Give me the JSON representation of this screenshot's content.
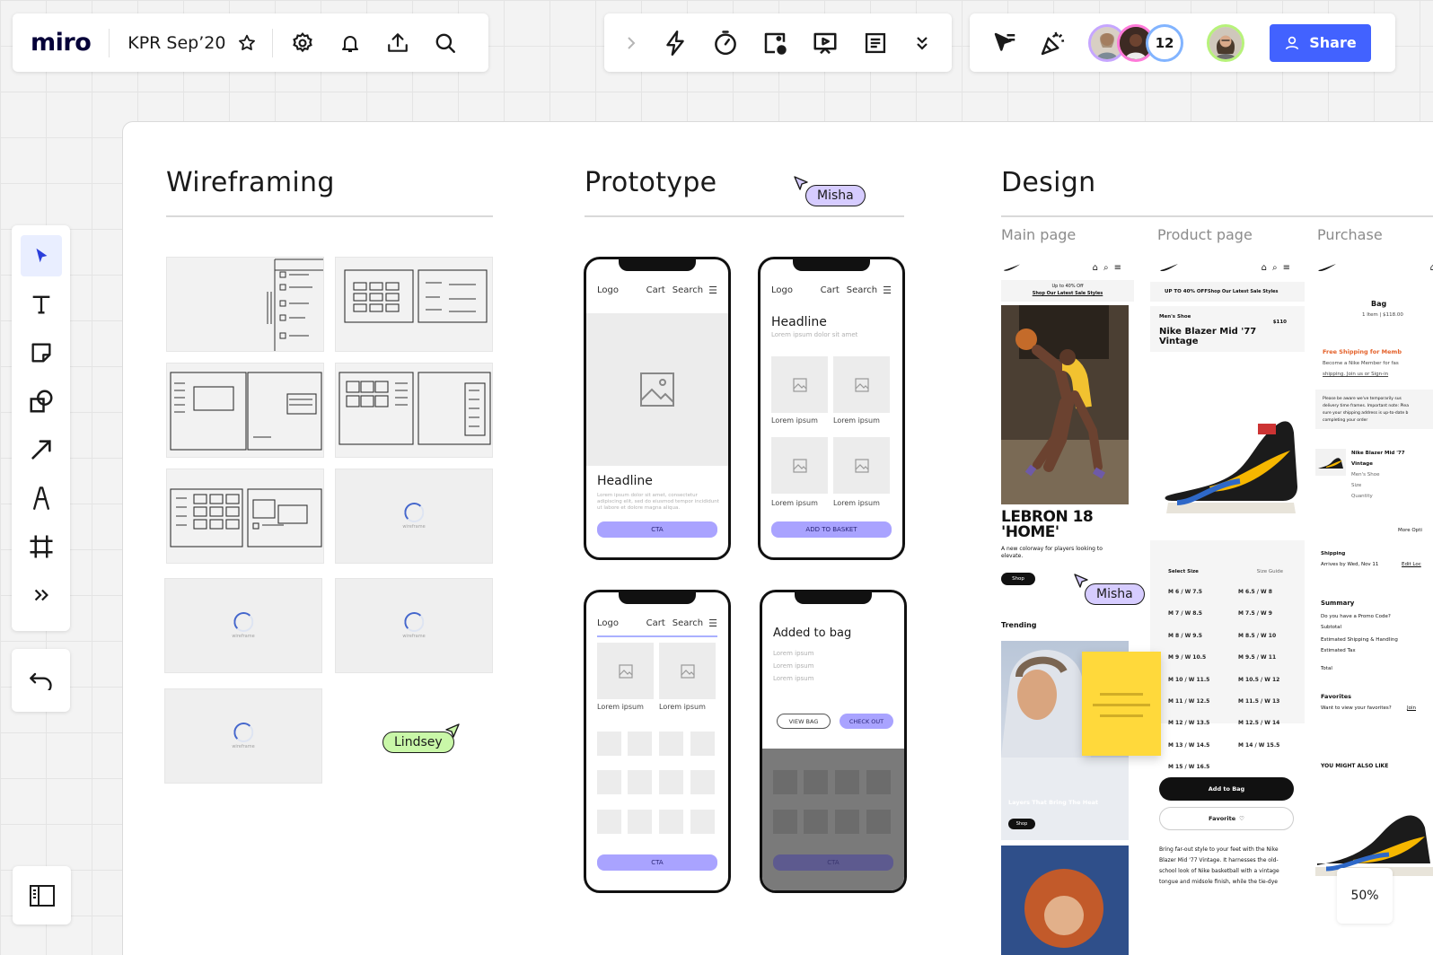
{
  "app": {
    "logo": "miro",
    "board_title": "KPR Sep’20",
    "collaborators_count": "12",
    "share_label": "Share",
    "zoom": "50%"
  },
  "icons": {
    "top_left": [
      "star-icon",
      "gear-icon",
      "bell-icon",
      "upload-icon",
      "search-icon"
    ],
    "top_middle": [
      "chevron-right-icon",
      "lightning-icon",
      "timer-icon",
      "image-plus-icon",
      "present-icon",
      "notes-icon",
      "double-chevron-down-icon"
    ],
    "top_right": [
      "cursor-list-icon",
      "celebrate-icon"
    ],
    "toolbar": [
      "select-icon",
      "text-icon",
      "sticky-note-icon",
      "shapes-icon",
      "arrow-icon",
      "pen-icon",
      "frame-icon",
      "more-icon"
    ]
  },
  "colors": {
    "brand": "#4262ff",
    "cta_purple": "#a9a3ff",
    "misha_tag": "#d6ccff",
    "lindsey_tag": "#c9f7a8",
    "sticky": "#ffd93b"
  },
  "sections": {
    "wireframing": {
      "title": "Wireframing",
      "loader_label": "wireframe"
    },
    "prototype": {
      "title": "Prototype"
    },
    "design": {
      "title": "Design",
      "columns": [
        "Main page",
        "Product page",
        "Purchase"
      ]
    }
  },
  "cursors": {
    "misha": "Misha",
    "lindsey": "Lindsey"
  },
  "prototype": {
    "phone1": {
      "nav_logo": "Logo",
      "nav_cart": "Cart",
      "nav_search": "Search",
      "headline": "Headline",
      "body": "Lorem ipsum dolor sit amet, consectetur adipiscing elit, sed do eiusmod tempor incididunt ut labore et dolore magna aliqua.",
      "cta": "CTA"
    },
    "phone2": {
      "nav_logo": "Logo",
      "nav_cart": "Cart",
      "nav_search": "Search",
      "headline": "Headline",
      "subtitle": "Lorem ipsum dolor sit amet",
      "captions": [
        "Lorem ipsum",
        "Lorem ipsum",
        "Lorem ipsum",
        "Lorem ipsum"
      ],
      "cta": "ADD TO BASKET"
    },
    "phone3": {
      "nav_logo": "Logo",
      "nav_cart": "Cart",
      "nav_search": "Search",
      "captions": [
        "Lorem ipsum",
        "Lorem ipsum"
      ],
      "cta": "CTA"
    },
    "phone4": {
      "title": "Added to bag",
      "lines": [
        "Lorem ipsum",
        "Lorem ipsum",
        "Lorem ipsum"
      ],
      "view_bag": "VIEW BAG",
      "checkout": "CHECK OUT",
      "cta": "CTA"
    }
  },
  "design": {
    "main": {
      "promo": "Up to 40% Off",
      "promo_link": "Shop Our Latest Sale Styles",
      "headline_1": "LEBRON 18",
      "headline_2": "'HOME'",
      "desc": "A new colorway for players looking to elevate.",
      "shop": "Shop",
      "trending": "Trending",
      "card_caption": "Layers That Bring The Heat",
      "card_shop": "Shop"
    },
    "product": {
      "promo": "UP TO 40% OFF",
      "promo_link": "Shop Our Latest Sale Styles",
      "category": "Men's Shoe",
      "price": "$110",
      "name": "Nike Blazer Mid '77 Vintage",
      "select_size": "Select Size",
      "size_guide": "Size Guide",
      "sizes": [
        [
          "M 6 / W 7.5",
          "M 6.5 / W 8"
        ],
        [
          "M 7 / W 8.5",
          "M 7.5 / W 9"
        ],
        [
          "M 8 / W 9.5",
          "M 8.5 / W 10"
        ],
        [
          "M 9 / W 10.5",
          "M 9.5 / W 11"
        ],
        [
          "M 10 / W 11.5",
          "M 10.5 / W 12"
        ],
        [
          "M 11 / W 12.5",
          "M 11.5 / W 13"
        ],
        [
          "M 12 / W 13.5",
          "M 12.5 / W 14"
        ],
        [
          "M 13 / W 14.5",
          "M 14 / W 15.5"
        ],
        [
          "M 15 / W 16.5",
          ""
        ]
      ],
      "add_to_bag": "Add to Bag",
      "favorite": "Favorite",
      "desc": "Bring far-out style to your feet with the Nike Blazer Mid '77 Vintage. It harnesses the old-school look of Nike basketball with a vintage tongue and midsole finish, while the tie-dye"
    },
    "purchase": {
      "bag": "Bag",
      "bag_meta": "1 Item | $118.00",
      "free_shipping": "Free Shipping for Memb",
      "member_line_1": "Become a Nike Member for fas",
      "member_line_2": "shipping. Join us or Sign-in",
      "notice_1": "Please be aware we've temporarily sus",
      "notice_2": "delivery time frames. Important note: Plea",
      "notice_3": "sure your shipping address is up-to-date b",
      "notice_4": "completing your order",
      "item_name_1": "Nike Blazer Mid '77",
      "item_name_2": "Vintage",
      "item_cat": "Men's Shoe",
      "item_size": "Size",
      "item_qty": "Quantity",
      "more": "More Opti",
      "shipping": "Shipping",
      "arrives": "Arrives by Wed, Nov 11",
      "edit": "Edit Loc",
      "summary": "Summary",
      "promo_q": "Do you have a Promo Code?",
      "subtotal": "Subtotal",
      "est_ship": "Estimated Shipping & Handling",
      "est_tax": "Estimated Tax",
      "total": "Total",
      "favorites": "Favorites",
      "fav_q": "Want to view your favorites?",
      "fav_join": "Join",
      "also_like": "YOU MIGHT ALSO LIKE"
    }
  }
}
